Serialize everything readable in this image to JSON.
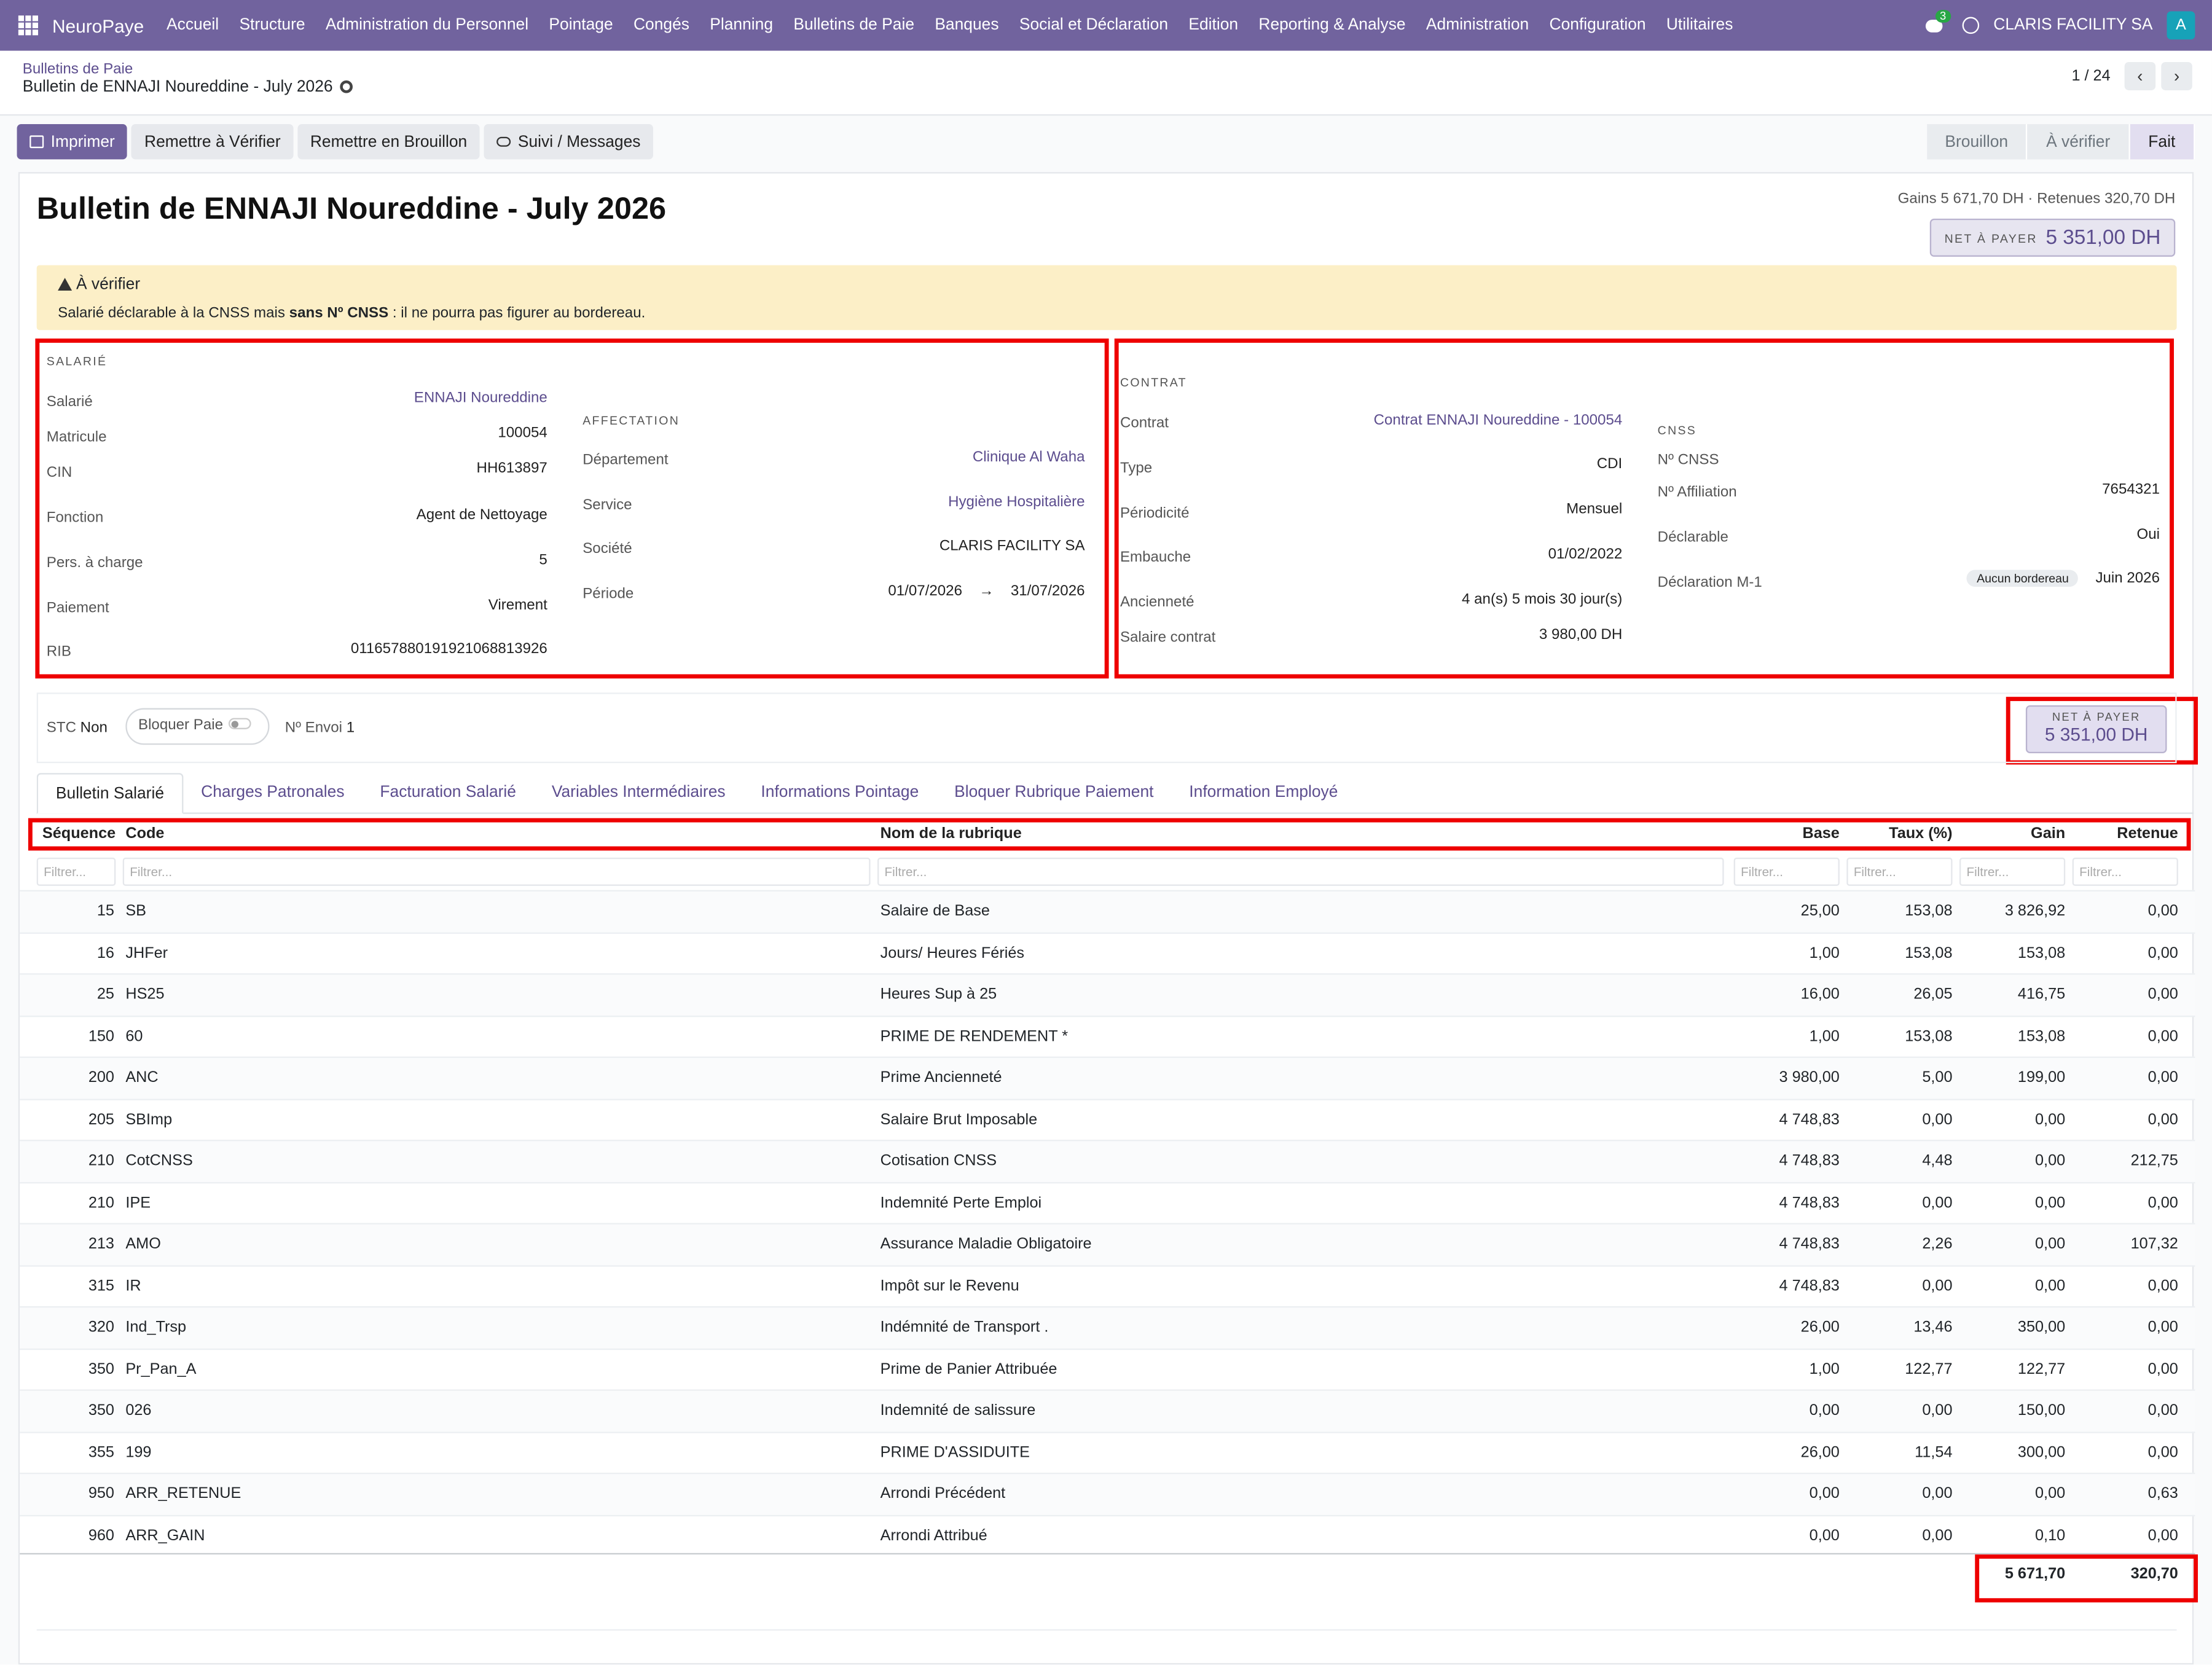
{
  "topnav": {
    "brand": "NeuroPaye",
    "menu": [
      "Accueil",
      "Structure",
      "Administration du Personnel",
      "Pointage",
      "Congés",
      "Planning",
      "Bulletins de Paie",
      "Banques",
      "Social et Déclaration",
      "Edition",
      "Reporting & Analyse",
      "Administration",
      "Configuration",
      "Utilitaires"
    ],
    "chat_count": "3",
    "company": "CLARIS FACILITY SA",
    "avatar_letter": "A"
  },
  "breadcrumb": {
    "parent": "Bulletins de Paie",
    "current": "Bulletin de ENNAJI Noureddine - July 2026"
  },
  "pager": {
    "value": "1 / 24",
    "prev": "‹",
    "next": "›"
  },
  "actions": {
    "print": "Imprimer",
    "to_verify": "Remettre à Vérifier",
    "to_draft": "Remettre en Brouillon",
    "messages": "Suivi / Messages"
  },
  "statusbar": {
    "steps": [
      "Brouillon",
      "À vérifier",
      "Fait"
    ],
    "current": "Fait"
  },
  "form": {
    "title": "Bulletin de ENNAJI Noureddine - July 2026",
    "gains_summary": "Gains 5 671,70 DH · Retenues 320,70 DH",
    "net_label": "NET À PAYER",
    "net_value": "5 351,00 DH",
    "alert_title": "À vérifier",
    "alert_text_1": "Salarié déclarable à la CNSS mais ",
    "alert_text_bold": "sans Nº CNSS",
    "alert_text_2": " : il ne pourra pas figurer au bordereau."
  },
  "salarie": {
    "section": "SALARIÉ",
    "labels": {
      "salarie": "Salarié",
      "matricule": "Matricule",
      "cin": "CIN",
      "fonction": "Fonction",
      "pers": "Pers. à charge",
      "paiement": "Paiement",
      "rib": "RIB"
    },
    "values": {
      "salarie": "ENNAJI Noureddine",
      "matricule": "100054",
      "cin": "HH613897",
      "fonction": "Agent de Nettoyage",
      "pers": "5",
      "paiement": "Virement",
      "rib": "011657880191921068813926"
    }
  },
  "affectation": {
    "section": "AFFECTATION",
    "labels": {
      "departement": "Département",
      "service": "Service",
      "societe": "Société",
      "periode": "Période"
    },
    "values": {
      "departement": "Clinique Al Waha",
      "service": "Hygiène Hospitalière",
      "societe": "CLARIS FACILITY SA",
      "periode_start": "01/07/2026",
      "periode_arrow": "→",
      "periode_end": "31/07/2026"
    }
  },
  "contrat": {
    "section": "CONTRAT",
    "labels": {
      "contrat": "Contrat",
      "type": "Type",
      "periodicite": "Périodicité",
      "embauche": "Embauche",
      "anciennete": "Ancienneté",
      "salaire": "Salaire contrat"
    },
    "values": {
      "contrat": "Contrat ENNAJI Noureddine - 100054",
      "type": "CDI",
      "periodicite": "Mensuel",
      "embauche": "01/02/2022",
      "anciennete": "4 an(s) 5 mois 30 jour(s)",
      "salaire": "3 980,00 DH"
    }
  },
  "cnss": {
    "section": "CNSS",
    "labels": {
      "num": "Nº CNSS",
      "affiliation": "Nº Affiliation",
      "declarable": "Déclarable",
      "declaration": "Déclaration M-1"
    },
    "values": {
      "num": "",
      "affiliation": "7654321",
      "declarable": "Oui",
      "declaration_badge": "Aucun bordereau",
      "declaration": "Juin 2026"
    }
  },
  "options": {
    "stc_label": "STC",
    "stc_value": "Non",
    "bloquer": "Bloquer Paie",
    "envoi_label": "Nº Envoi",
    "envoi_value": "1",
    "net_label": "NET À PAYER",
    "net_value": "5 351,00 DH"
  },
  "tabs": [
    "Bulletin Salarié",
    "Charges Patronales",
    "Facturation Salarié",
    "Variables Intermédiaires",
    "Informations Pointage",
    "Bloquer Rubrique Paiement",
    "Information Employé"
  ],
  "table": {
    "headers": {
      "seq": "Séquence",
      "code": "Code",
      "nom": "Nom de la rubrique",
      "base": "Base",
      "taux": "Taux (%)",
      "gain": "Gain",
      "retenue": "Retenue"
    },
    "filter_placeholder": "Filtrer...",
    "rows": [
      {
        "seq": "15",
        "code": "SB",
        "nom": "Salaire de Base",
        "base": "25,00",
        "taux": "153,08",
        "gain": "3 826,92",
        "retenue": "0,00"
      },
      {
        "seq": "16",
        "code": "JHFer",
        "nom": "Jours/ Heures Fériés",
        "base": "1,00",
        "taux": "153,08",
        "gain": "153,08",
        "retenue": "0,00"
      },
      {
        "seq": "25",
        "code": "HS25",
        "nom": "Heures Sup à 25",
        "base": "16,00",
        "taux": "26,05",
        "gain": "416,75",
        "retenue": "0,00"
      },
      {
        "seq": "150",
        "code": "60",
        "nom": "PRIME DE RENDEMENT *",
        "base": "1,00",
        "taux": "153,08",
        "gain": "153,08",
        "retenue": "0,00"
      },
      {
        "seq": "200",
        "code": "ANC",
        "nom": "Prime Ancienneté",
        "base": "3 980,00",
        "taux": "5,00",
        "gain": "199,00",
        "retenue": "0,00"
      },
      {
        "seq": "205",
        "code": "SBImp",
        "nom": "Salaire Brut Imposable",
        "base": "4 748,83",
        "taux": "0,00",
        "gain": "0,00",
        "retenue": "0,00"
      },
      {
        "seq": "210",
        "code": "CotCNSS",
        "nom": "Cotisation CNSS",
        "base": "4 748,83",
        "taux": "4,48",
        "gain": "0,00",
        "retenue": "212,75"
      },
      {
        "seq": "210",
        "code": "IPE",
        "nom": "Indemnité Perte Emploi",
        "base": "4 748,83",
        "taux": "0,00",
        "gain": "0,00",
        "retenue": "0,00"
      },
      {
        "seq": "213",
        "code": "AMO",
        "nom": "Assurance Maladie Obligatoire",
        "base": "4 748,83",
        "taux": "2,26",
        "gain": "0,00",
        "retenue": "107,32"
      },
      {
        "seq": "315",
        "code": "IR",
        "nom": "Impôt sur le Revenu",
        "base": "4 748,83",
        "taux": "0,00",
        "gain": "0,00",
        "retenue": "0,00"
      },
      {
        "seq": "320",
        "code": "Ind_Trsp",
        "nom": "Indémnité de Transport .",
        "base": "26,00",
        "taux": "13,46",
        "gain": "350,00",
        "retenue": "0,00"
      },
      {
        "seq": "350",
        "code": "Pr_Pan_A",
        "nom": "Prime de Panier Attribuée",
        "base": "1,00",
        "taux": "122,77",
        "gain": "122,77",
        "retenue": "0,00"
      },
      {
        "seq": "350",
        "code": "026",
        "nom": "Indemnité de salissure",
        "base": "0,00",
        "taux": "0,00",
        "gain": "150,00",
        "retenue": "0,00"
      },
      {
        "seq": "355",
        "code": "199",
        "nom": "PRIME D'ASSIDUITE",
        "base": "26,00",
        "taux": "11,54",
        "gain": "300,00",
        "retenue": "0,00"
      },
      {
        "seq": "950",
        "code": "ARR_RETENUE",
        "nom": "Arrondi Précédent",
        "base": "0,00",
        "taux": "0,00",
        "gain": "0,00",
        "retenue": "0,63"
      },
      {
        "seq": "960",
        "code": "ARR_GAIN",
        "nom": "Arrondi Attribué",
        "base": "0,00",
        "taux": "0,00",
        "gain": "0,10",
        "retenue": "0,00"
      }
    ],
    "totals": {
      "gain": "5 671,70",
      "retenue": "320,70"
    }
  },
  "colors": {
    "brand": "#71639e",
    "link": "#5c4d8e",
    "alert_bg": "#fcefc7",
    "highlight": "#e00000"
  }
}
